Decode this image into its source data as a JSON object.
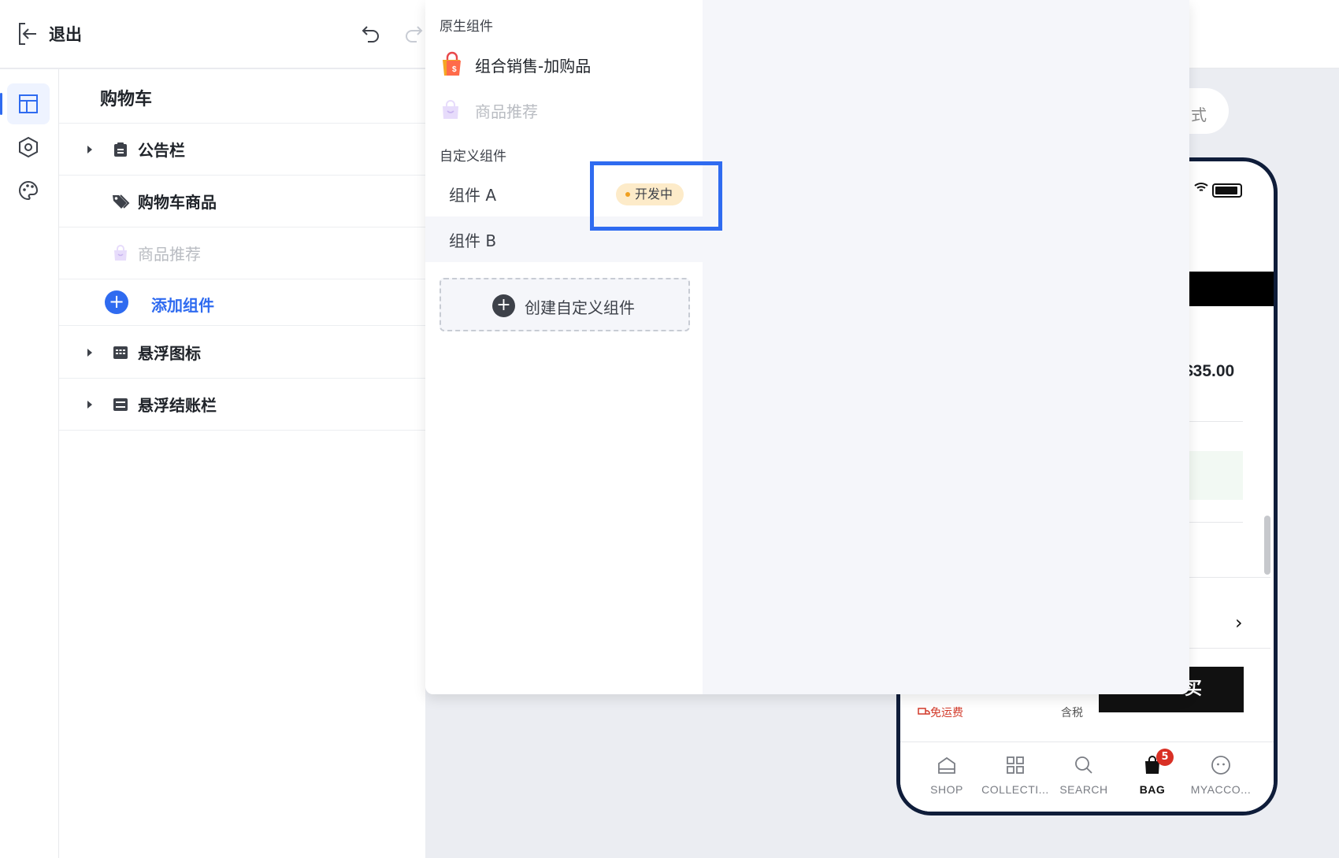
{
  "toolbar": {
    "exit_label": "退出"
  },
  "tree": {
    "title": "购物车",
    "rows": [
      {
        "label": "公告栏"
      },
      {
        "label": "购物车商品"
      },
      {
        "label": "商品推荐"
      },
      {
        "label": "悬浮图标"
      },
      {
        "label": "悬浮结账栏"
      }
    ],
    "add_label": "添加组件"
  },
  "dropdown": {
    "native_title": "原生组件",
    "native_items": [
      {
        "label": "组合销售-加购品"
      },
      {
        "label": "商品推荐"
      }
    ],
    "custom_title": "自定义组件",
    "custom_items": [
      {
        "label": "组件 A",
        "badge": "开发中"
      },
      {
        "label": "组件 B"
      }
    ],
    "create_label": "创建自定义组件"
  },
  "preview": {
    "pill_text": "式",
    "price": "$35.00",
    "buy_label": "买",
    "free_shipping": "免运费",
    "tax_label": "含税",
    "tabs": [
      {
        "label": "SHOP"
      },
      {
        "label": "COLLECTI..."
      },
      {
        "label": "SEARCH"
      },
      {
        "label": "BAG",
        "badge": "5"
      },
      {
        "label": "MYACCO..."
      }
    ]
  },
  "colors": {
    "accent": "#2f6bf0",
    "badge_bg": "#fdebc9",
    "badge_dot": "#f0a020",
    "cart_badge": "#d93025"
  }
}
